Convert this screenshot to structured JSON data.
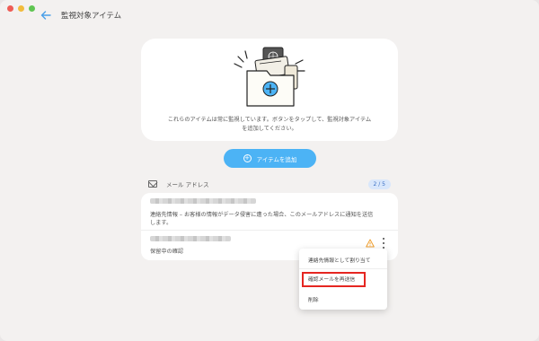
{
  "window": {
    "title": "監視対象アイテム"
  },
  "hero": {
    "text_line1": "これらのアイテムは常に監視しています。ボタンをタップして、監視対象アイテム",
    "text_line2": "を追加してください。"
  },
  "add_button": {
    "label": "アイテムを追加"
  },
  "section": {
    "title": "メール アドレス",
    "count": "2 / 5"
  },
  "email_card": {
    "description_line1": "連絡先情報 – お客様の情報がデータ侵害に遭った場合、このメールアドレスに通知を送信",
    "description_line2": "します。",
    "pending_label": "保留中の確認"
  },
  "context_menu": {
    "items": [
      "連絡先情報として割り当て",
      "確認メールを再送信",
      "削除"
    ]
  },
  "colors": {
    "accent": "#4cb3f5",
    "highlight": "#e52621",
    "warning": "#f0a030"
  },
  "icons": [
    "back-arrow-icon",
    "mail-icon",
    "plus-circle-icon",
    "warning-icon",
    "more-vert-icon"
  ]
}
